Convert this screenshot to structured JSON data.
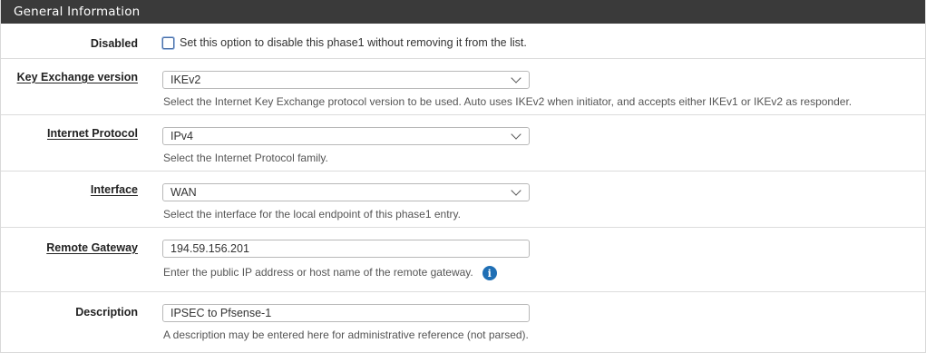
{
  "panel": {
    "title": "General Information"
  },
  "fields": {
    "disabled": {
      "label": "Disabled",
      "checkbox_text": "Set this option to disable this phase1 without removing it from the list."
    },
    "key_exchange": {
      "label": "Key Exchange version",
      "selected": "IKEv2",
      "help": "Select the Internet Key Exchange protocol version to be used. Auto uses IKEv2 when initiator, and accepts either IKEv1 or IKEv2 as responder."
    },
    "internet_protocol": {
      "label": "Internet Protocol",
      "selected": "IPv4",
      "help": "Select the Internet Protocol family."
    },
    "interface": {
      "label": "Interface",
      "selected": "WAN",
      "help": "Select the interface for the local endpoint of this phase1 entry."
    },
    "remote_gateway": {
      "label": "Remote Gateway",
      "value": "194.59.156.201",
      "help": "Enter the public IP address or host name of the remote gateway."
    },
    "description": {
      "label": "Description",
      "value": "IPSEC to Pfsense-1",
      "help": "A description may be entered here for administrative reference (not parsed)."
    }
  },
  "icons": {
    "info": "info-icon",
    "dropdown": "chevron-down-icon"
  },
  "colors": {
    "header_bg": "#3a3a3a",
    "info_icon": "#1f6fb5"
  }
}
